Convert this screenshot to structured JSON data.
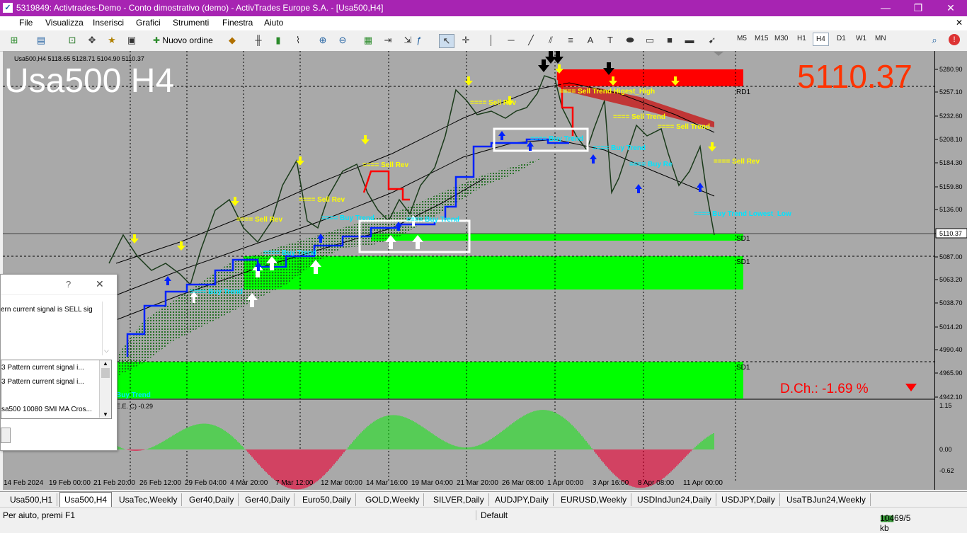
{
  "window": {
    "title": "5319849: Activtrades-Demo - Conto dimostrativo (demo) - ActivTrades Europe S.A. - [Usa500,H4]",
    "minimize": "—",
    "restore": "❐",
    "close": "✕"
  },
  "menu": [
    "File",
    "Visualizza",
    "Inserisci",
    "Grafici",
    "Strumenti",
    "Finestra",
    "Aiuto"
  ],
  "toolbar": {
    "new_order": "Nuovo ordine",
    "timeframes": [
      "M5",
      "M15",
      "M30",
      "H1",
      "H4",
      "D1",
      "W1",
      "MN"
    ],
    "active_timeframe": "H4"
  },
  "chart": {
    "header": "Usa500,H4  5118.65 5128.71 5104.90 5110.37",
    "big_label": "Usa500 H4",
    "big_price": "5110.37",
    "daily_change": "D.Ch.: -1.69 %",
    "indicator_header": "E.E. C) -0.29",
    "price_ticks": [
      "5280.90",
      "5257.10",
      "5232.60",
      "5208.10",
      "5184.30",
      "5159.80",
      "5136.00",
      "5110.37",
      "5087.00",
      "5063.20",
      "5038.70",
      "5014.20",
      "4990.40",
      "4965.90",
      "4942.10"
    ],
    "indicator_ticks": [
      "1.15",
      "0.00",
      "-0.62"
    ],
    "date_ticks": [
      "14 Feb 2024",
      "19 Feb 00:00",
      "21 Feb 20:00",
      "26 Feb 12:00",
      "29 Feb 04:00",
      "4 Mar 20:00",
      "7 Mar 12:00",
      "12 Mar 00:00",
      "14 Mar 16:00",
      "19 Mar 04:00",
      "21 Mar 20:00",
      "26 Mar 08:00",
      "1 Apr 00:00",
      "3 Apr 16:00",
      "8 Apr 08:00",
      "11 Apr 00:00"
    ],
    "zone_labels": {
      "rd1": "RD1",
      "sd1_a": "SD1",
      "sd1_b": "SD1",
      "sd1_c": "SD1"
    },
    "annotations": {
      "sell_rev": "==== Sell Rev",
      "buy_trend": "==== Buy Trend",
      "sell_trend": "==== Sell Trend",
      "sell_trend_hh": "==== Sell Trend  Higest_High",
      "buy_trend_ll": "==== Buy Trend  Lowest_Low",
      "buy_re": "==== Buy Re",
      "buy_trend_short": "Buy Trend"
    }
  },
  "dialog": {
    "help": "?",
    "close": "✕",
    "message": "ern  current signal is SELL sig",
    "list": [
      "3 Pattern  current signal i...",
      "3 Pattern  current signal i...",
      "sa500  10080 SMI MA Cros..."
    ]
  },
  "tabs": [
    "Usa500,H1",
    "Usa500,H4",
    "UsaTec,Weekly",
    "Ger40,Daily",
    "Ger40,Daily",
    "Euro50,Daily",
    "GOLD,Weekly",
    "SILVER,Daily",
    "AUDJPY,Daily",
    "EURUSD,Weekly",
    "USDIndJun24,Daily",
    "USDJPY,Daily",
    "UsaTBJun24,Weekly"
  ],
  "active_tab": "Usa500,H4",
  "status": {
    "help": "Per aiuto, premi F1",
    "profile": "Default",
    "traffic": "10469/5 kb"
  },
  "colors": {
    "titlebar": "#a724b2",
    "chart_bg": "#a9a9a9",
    "demand_zone": "#00ff00",
    "supply_zone": "#ff0000",
    "big_price": "#ff3300"
  }
}
